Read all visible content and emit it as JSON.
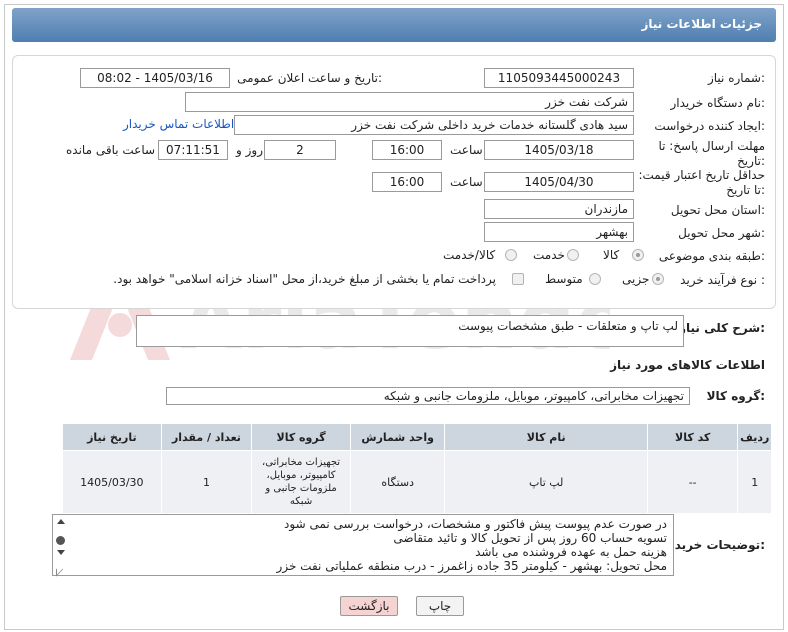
{
  "header": {
    "title": "جزئیات اطلاعات نیاز"
  },
  "form": {
    "need_number_label": "شماره نیاز:",
    "need_number": "1105093445000243",
    "announce_label": "تاریخ و ساعت اعلان عمومی:",
    "announce_value": "1405/03/16 - 08:02",
    "buyer_label": "نام دستگاه خریدار:",
    "buyer_value": "شرکت نفت خزر",
    "creator_label": "ایجاد کننده درخواست:",
    "creator_value": "سید هادی گلستانه خدمات خرید داخلی شرکت نفت خزر",
    "contact_link": "اطلاعات تماس خریدار",
    "deadline_label": "مهلت ارسال پاسخ: تا تاریخ:",
    "deadline_date": "1405/03/18",
    "time_label": "ساعت",
    "deadline_time": "16:00",
    "days_value": "2",
    "days_label": "روز و",
    "remaining_time": "07:11:51",
    "remaining_label": "ساعت باقی مانده",
    "validity_label": "حداقل تاریخ اعتبار قیمت: تا تاریخ:",
    "validity_date": "1405/04/30",
    "validity_time": "16:00",
    "province_label": "استان محل تحویل:",
    "province_value": "مازندران",
    "city_label": "شهر محل تحویل:",
    "city_value": "بهشهر",
    "category_label": "طبقه بندی موضوعی:",
    "category_options": [
      "کالا",
      "خدمت",
      "کالا/خدمت"
    ],
    "process_label": "نوع فرآیند خرید :",
    "process_options": [
      "جزیی",
      "متوسط"
    ],
    "payment_note": "پرداخت تمام یا بخشی از مبلغ خرید،از محل \"اسناد خزانه اسلامی\" خواهد بود."
  },
  "summary": {
    "label": "شرح کلی نیاز:",
    "value": "لپ تاپ و متعلقات - طبق مشخصات پیوست"
  },
  "goods_info_title": "اطلاعات کالاهای مورد نیاز",
  "goods_group": {
    "label": "گروه کالا:",
    "value": "تجهیزات مخابراتی، کامپیوتر، موبایل، ملزومات جانبی و شبکه"
  },
  "table": {
    "headers": [
      "ردیف",
      "کد کالا",
      "نام کالا",
      "واحد شمارش",
      "گروه کالا",
      "تعداد / مقدار",
      "تاریخ نیاز"
    ],
    "rows": [
      [
        "1",
        "--",
        "لپ تاپ",
        "دستگاه",
        "تجهیزات مخابراتی، کامپیوتر، موبایل، ملزومات جانبی و شبکه",
        "1",
        "1405/03/30"
      ]
    ]
  },
  "buyer_notes": {
    "label": "توضیحات خریدار:",
    "lines": [
      "در صورت عدم پیوست پیش فاکتور و مشخصات، درخواست بررسی نمی شود",
      "تسویه حساب 60 روز پس از تحویل کالا و تائید متقاضی",
      "هزینه حمل به عهده فروشنده می باشد",
      "محل تحویل: بهشهر - کیلومتر 35 جاده زاغمرز - درب منطقه عملیاتی نفت خزر"
    ]
  },
  "buttons": {
    "print": "چاپ",
    "back": "بازگشت"
  },
  "watermark_text": "AriaTender.neT",
  "colors": {
    "header": "#5b85b4",
    "link": "#1a55c4",
    "back_button": "#f6d3d3",
    "table_header": "#cdd5df"
  }
}
